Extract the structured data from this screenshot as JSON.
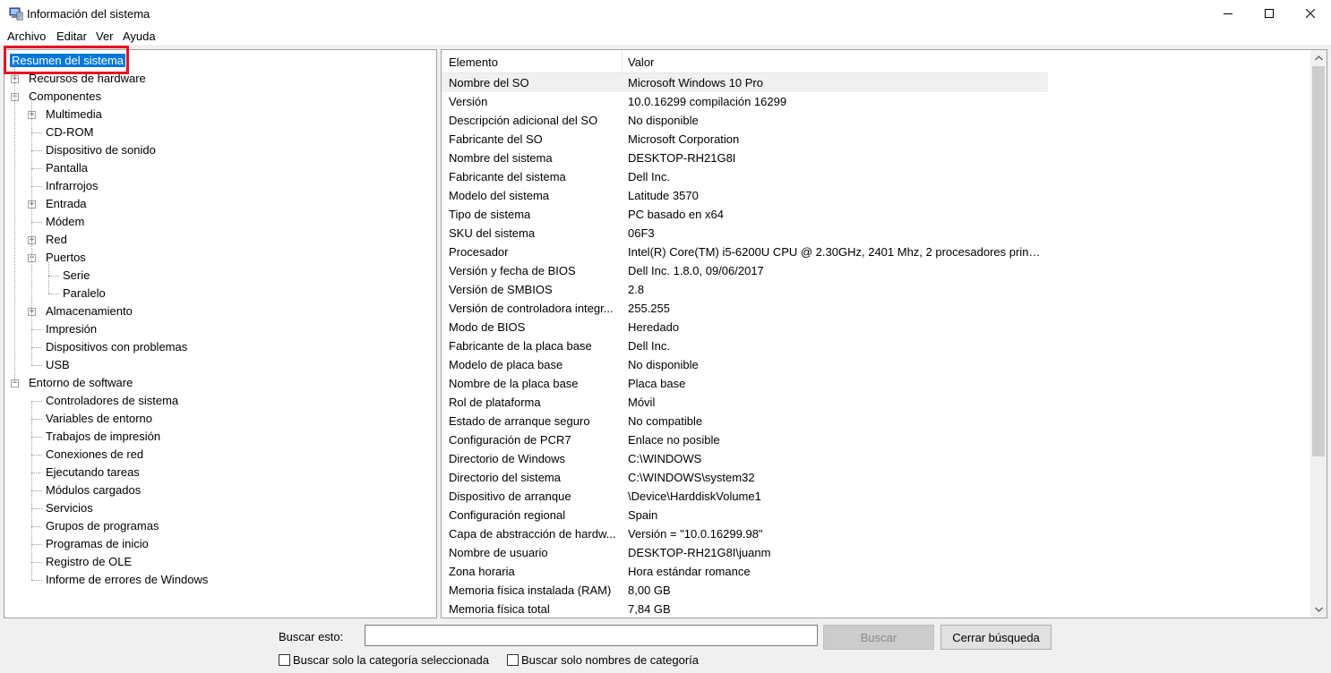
{
  "window": {
    "title": "Información del sistema",
    "minimize_glyph": "—",
    "maximize_glyph": "☐",
    "close_glyph": "✕"
  },
  "menu": [
    "Archivo",
    "Editar",
    "Ver",
    "Ayuda"
  ],
  "tree": {
    "selected": "Resumen del sistema",
    "items": [
      {
        "label": "Recursos de hardware",
        "level": 0,
        "expander": "+"
      },
      {
        "label": "Componentes",
        "level": 0,
        "expander": "-"
      },
      {
        "label": "Multimedia",
        "level": 1,
        "expander": "+"
      },
      {
        "label": "CD-ROM",
        "level": 1,
        "expander": ""
      },
      {
        "label": "Dispositivo de sonido",
        "level": 1,
        "expander": ""
      },
      {
        "label": "Pantalla",
        "level": 1,
        "expander": ""
      },
      {
        "label": "Infrarrojos",
        "level": 1,
        "expander": ""
      },
      {
        "label": "Entrada",
        "level": 1,
        "expander": "+"
      },
      {
        "label": "Módem",
        "level": 1,
        "expander": ""
      },
      {
        "label": "Red",
        "level": 1,
        "expander": "+"
      },
      {
        "label": "Puertos",
        "level": 1,
        "expander": "-"
      },
      {
        "label": "Serie",
        "level": 2,
        "expander": ""
      },
      {
        "label": "Paralelo",
        "level": 2,
        "expander": ""
      },
      {
        "label": "Almacenamiento",
        "level": 1,
        "expander": "+"
      },
      {
        "label": "Impresión",
        "level": 1,
        "expander": ""
      },
      {
        "label": "Dispositivos con problemas",
        "level": 1,
        "expander": ""
      },
      {
        "label": "USB",
        "level": 1,
        "expander": ""
      },
      {
        "label": "Entorno de software",
        "level": 0,
        "expander": "-"
      },
      {
        "label": "Controladores de sistema",
        "level": 1,
        "expander": ""
      },
      {
        "label": "Variables de entorno",
        "level": 1,
        "expander": ""
      },
      {
        "label": "Trabajos de impresión",
        "level": 1,
        "expander": ""
      },
      {
        "label": "Conexiones de red",
        "level": 1,
        "expander": ""
      },
      {
        "label": "Ejecutando tareas",
        "level": 1,
        "expander": ""
      },
      {
        "label": "Módulos cargados",
        "level": 1,
        "expander": ""
      },
      {
        "label": "Servicios",
        "level": 1,
        "expander": ""
      },
      {
        "label": "Grupos de programas",
        "level": 1,
        "expander": ""
      },
      {
        "label": "Programas de inicio",
        "level": 1,
        "expander": ""
      },
      {
        "label": "Registro de OLE",
        "level": 1,
        "expander": ""
      },
      {
        "label": "Informe de errores de Windows",
        "level": 1,
        "expander": ""
      }
    ]
  },
  "details": {
    "columns": [
      "Elemento",
      "Valor"
    ],
    "rows": [
      [
        "Nombre del SO",
        "Microsoft Windows 10 Pro"
      ],
      [
        "Versión",
        "10.0.16299 compilación 16299"
      ],
      [
        "Descripción adicional del SO",
        "No disponible"
      ],
      [
        "Fabricante del SO",
        "Microsoft Corporation"
      ],
      [
        "Nombre del sistema",
        "DESKTOP-RH21G8I"
      ],
      [
        "Fabricante del sistema",
        "Dell Inc."
      ],
      [
        "Modelo del sistema",
        "Latitude 3570"
      ],
      [
        "Tipo de sistema",
        "PC basado en x64"
      ],
      [
        "SKU del sistema",
        "06F3"
      ],
      [
        "Procesador",
        "Intel(R) Core(TM) i5-6200U CPU @ 2.30GHz, 2401 Mhz, 2 procesadores princi..."
      ],
      [
        "Versión y fecha de BIOS",
        "Dell Inc. 1.8.0, 09/06/2017"
      ],
      [
        "Versión de SMBIOS",
        "2.8"
      ],
      [
        "Versión de controladora integr...",
        "255.255"
      ],
      [
        "Modo de BIOS",
        "Heredado"
      ],
      [
        "Fabricante de la placa base",
        "Dell Inc."
      ],
      [
        "Modelo de placa base",
        "No disponible"
      ],
      [
        "Nombre de la placa base",
        "Placa base"
      ],
      [
        "Rol de plataforma",
        "Móvil"
      ],
      [
        "Estado de arranque seguro",
        "No compatible"
      ],
      [
        "Configuración de PCR7",
        "Enlace no posible"
      ],
      [
        "Directorio de Windows",
        "C:\\WINDOWS"
      ],
      [
        "Directorio del sistema",
        "C:\\WINDOWS\\system32"
      ],
      [
        "Dispositivo de arranque",
        "\\Device\\HarddiskVolume1"
      ],
      [
        "Configuración regional",
        "Spain"
      ],
      [
        "Capa de abstracción de hardw...",
        "Versión = \"10.0.16299.98\""
      ],
      [
        "Nombre de usuario",
        "DESKTOP-RH21G8I\\juanm"
      ],
      [
        "Zona horaria",
        "Hora estándar romance"
      ],
      [
        "Memoria física instalada (RAM)",
        "8,00 GB"
      ],
      [
        "Memoria física total",
        "7,84 GB"
      ]
    ]
  },
  "search": {
    "label": "Buscar esto:",
    "value": "",
    "search_button": "Buscar",
    "close_button": "Cerrar búsqueda",
    "check_category": "Buscar solo la categoría seleccionada",
    "check_names": "Buscar solo nombres de categoría"
  },
  "colors": {
    "selection": "#0078d7",
    "highlight_box": "#e81123"
  }
}
